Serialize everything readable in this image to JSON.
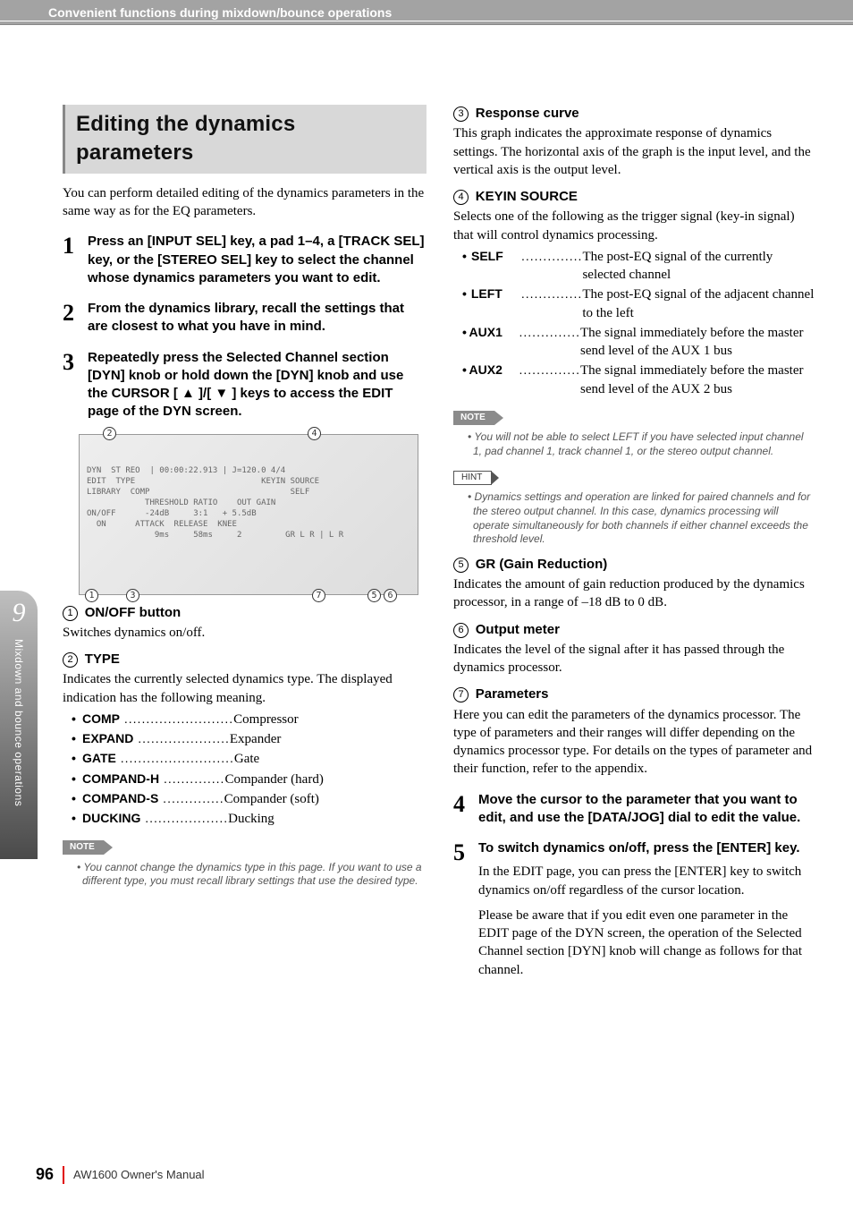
{
  "header": {
    "breadcrumb": "Convenient functions during mixdown/bounce operations"
  },
  "sideTab": {
    "chapter": "9",
    "label": "Mixdown and bounce operations"
  },
  "footer": {
    "page": "96",
    "manual": "AW1600  Owner's Manual"
  },
  "section": {
    "title": "Editing the dynamics parameters"
  },
  "lead": "You can perform detailed editing of the dynamics parameters in the same way as for the EQ parameters.",
  "steps": {
    "s1": "Press an [INPUT SEL] key, a pad 1–4, a [TRACK SEL] key, or the [STEREO SEL] key to select the channel whose dynamics parameters you want to edit.",
    "s2": "From the dynamics library, recall the settings that are closest to what you have in mind.",
    "s3_pre": "Repeatedly press the Selected Channel section [DYN] knob or hold down the [DYN] knob and use the CURSOR [ ",
    "s3_mid": " ]/[ ",
    "s3_post": " ] keys to access the EDIT page of the DYN screen.",
    "s4": "Move the cursor to the parameter that you want to edit, and use the [DATA/JOG] dial to edit the value.",
    "s5": "To switch dynamics on/off, press the [ENTER] key.",
    "s5_p1": "In the EDIT page, you can press the [ENTER] key to switch dynamics on/off regardless of the cursor location.",
    "s5_p2": "Please be aware that if you edit even one parameter in the EDIT page of the DYN screen, the operation of the Selected Channel section [DYN] knob will change as follows for that channel."
  },
  "items": {
    "i1": {
      "num": "1",
      "title": "ON/OFF button",
      "desc": "Switches dynamics on/off."
    },
    "i2": {
      "num": "2",
      "title": "TYPE",
      "desc": "Indicates the currently selected dynamics type. The displayed indication has the following meaning."
    },
    "i3": {
      "num": "3",
      "title": "Response curve",
      "desc": "This graph indicates the approximate response of dynamics settings. The horizontal axis of the graph is the input level, and the vertical axis is the output level."
    },
    "i4": {
      "num": "4",
      "title": "KEYIN SOURCE",
      "desc": "Selects one of the following as the trigger signal (key-in signal) that will control dynamics processing."
    },
    "i5": {
      "num": "5",
      "title": "GR (Gain Reduction)",
      "desc": "Indicates the amount of gain reduction produced by the dynamics processor, in a range of –18 dB to 0 dB."
    },
    "i6": {
      "num": "6",
      "title": "Output meter",
      "desc": "Indicates the level of the signal after it has passed through the dynamics processor."
    },
    "i7": {
      "num": "7",
      "title": "Parameters",
      "desc": "Here you can edit the parameters of the dynamics processor. The type of parameters and their ranges will differ depending on the dynamics processor type. For details on the types of parameter and their function, refer to the appendix."
    }
  },
  "typeList": [
    {
      "term": "COMP",
      "dots": " .........................",
      "def": "Compressor"
    },
    {
      "term": "EXPAND",
      "dots": " .....................",
      "def": "Expander"
    },
    {
      "term": "GATE",
      "dots": " ..........................",
      "def": "Gate"
    },
    {
      "term": "COMPAND-H",
      "dots": " ..............",
      "def": "Compander (hard)"
    },
    {
      "term": "COMPAND-S",
      "dots": " ..............",
      "def": "Compander (soft)"
    },
    {
      "term": "DUCKING",
      "dots": " ...................",
      "def": "Ducking"
    }
  ],
  "keyinList": [
    {
      "term": "SELF",
      "dots": " ..............",
      "def": " The post-EQ signal of the currently selected channel"
    },
    {
      "term": "LEFT",
      "dots": " ..............",
      "def": " The post-EQ signal of the adjacent channel to the left"
    },
    {
      "term": "AUX1",
      "dots": " ..............",
      "def": " The signal immediately before the master send level of the AUX 1 bus"
    },
    {
      "term": "AUX2",
      "dots": " ..............",
      "def": " The signal immediately before the master send level of the AUX 2 bus"
    }
  ],
  "notes": {
    "note1": "• You cannot change the dynamics type in this page. If you want to use a different type, you must recall library settings that use the desired type.",
    "note2": "• You will not be able to select LEFT if you have selected input channel 1, pad channel 1, track channel 1, or the stereo output channel.",
    "hint1": "• Dynamics settings and operation are linked for paired channels and for the stereo output channel. In this case, dynamics processing will operate simultaneously for both channels if either channel exceeds the threshold level."
  },
  "labels": {
    "note": "NOTE",
    "hint": "HINT"
  },
  "tri": {
    "up": "▲",
    "down": "▼"
  }
}
